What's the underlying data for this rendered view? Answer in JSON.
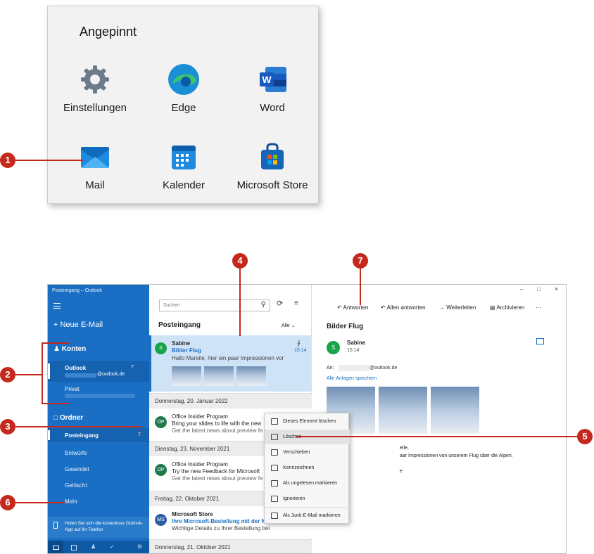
{
  "start_panel": {
    "title": "Angepinnt",
    "apps": [
      {
        "label": "Einstellungen",
        "icon": "gear-icon"
      },
      {
        "label": "Edge",
        "icon": "edge-icon"
      },
      {
        "label": "Word",
        "icon": "word-icon"
      },
      {
        "label": "Mail",
        "icon": "mail-icon"
      },
      {
        "label": "Kalender",
        "icon": "calendar-icon"
      },
      {
        "label": "Microsoft Store",
        "icon": "store-icon"
      }
    ]
  },
  "window": {
    "title": "Posteingang – Outlook",
    "controls": {
      "minimize": "–",
      "maximize": "□",
      "close": "×"
    }
  },
  "nav": {
    "new_mail": "Neue E-Mail",
    "accounts_header": "Konten",
    "accounts": [
      {
        "name": "Outlook",
        "count": "7",
        "address": "@outlook.de"
      },
      {
        "name": "Privat",
        "count": "",
        "address": ""
      }
    ],
    "folders_header": "Ordner",
    "folders": [
      {
        "name": "Posteingang",
        "count": "7"
      },
      {
        "name": "Entwürfe",
        "count": ""
      },
      {
        "name": "Gesendet",
        "count": ""
      },
      {
        "name": "Gelöscht",
        "count": ""
      },
      {
        "name": "Mehr",
        "count": ""
      }
    ],
    "promo": "Holen Sie sich die kostenlose Outlook-App auf Ihr Telefon"
  },
  "list": {
    "search_placeholder": "Suchen",
    "header": "Posteingang",
    "filter": "Alle",
    "groups": [
      {
        "date": "Donnerstag, 20. Januar 2022"
      },
      {
        "date": "Dienstag, 23. November 2021"
      },
      {
        "date": "Freitag, 22. Oktober 2021"
      },
      {
        "date": "Donnerstag, 21. Oktober 2021"
      }
    ],
    "messages": [
      {
        "initials": "S",
        "sender": "Sabine",
        "subject": "Bilder Flug",
        "time": "15:14",
        "preview": "Hallo Mareile, hier ein paar Impressionen vor"
      },
      {
        "initials": "OP",
        "sender": "Office Insider Program",
        "subject": "Bring your slides to life with the new",
        "time": "",
        "preview": "Get the latest news about preview fe"
      },
      {
        "initials": "OP",
        "sender": "Office Insider Program",
        "subject": "Try the new Feedback for Microsoft",
        "time": "",
        "preview": "Get the latest news about preview fe"
      },
      {
        "initials": "MS",
        "sender": "Microsoft Store",
        "subject": "Ihre Microsoft-Bestellung mit der N",
        "time": "",
        "preview": "Wichtige Details zu Ihrer Bestellung bei"
      }
    ]
  },
  "reader": {
    "actions": [
      "Antworten",
      "Allen antworten",
      "Weiterleiten",
      "Archivieren",
      "···"
    ],
    "subject": "Bilder Flug",
    "sender": "Sabine",
    "initials": "S",
    "time": "15:14",
    "to_label": "An:",
    "to_address": "@outlook.de",
    "save_attachments": "Alle Anlagen speichern",
    "body_line1": "eile,",
    "body_line2": "aar Impressionen von unserem Flug über die Alpen.",
    "body_line3": "e"
  },
  "context_menu": {
    "items": [
      "Dieses Element löschen",
      "Löschen",
      "Verschieben",
      "Kennzeichnen",
      "Als ungelesen markieren",
      "Ignorieren",
      "Als Junk-E-Mail markieren"
    ]
  },
  "callouts": [
    "1",
    "2",
    "3",
    "4",
    "5",
    "6",
    "7"
  ],
  "colors": {
    "accent": "#1a6fc4",
    "callout": "#c5281c",
    "selected": "#cfe3f7"
  }
}
